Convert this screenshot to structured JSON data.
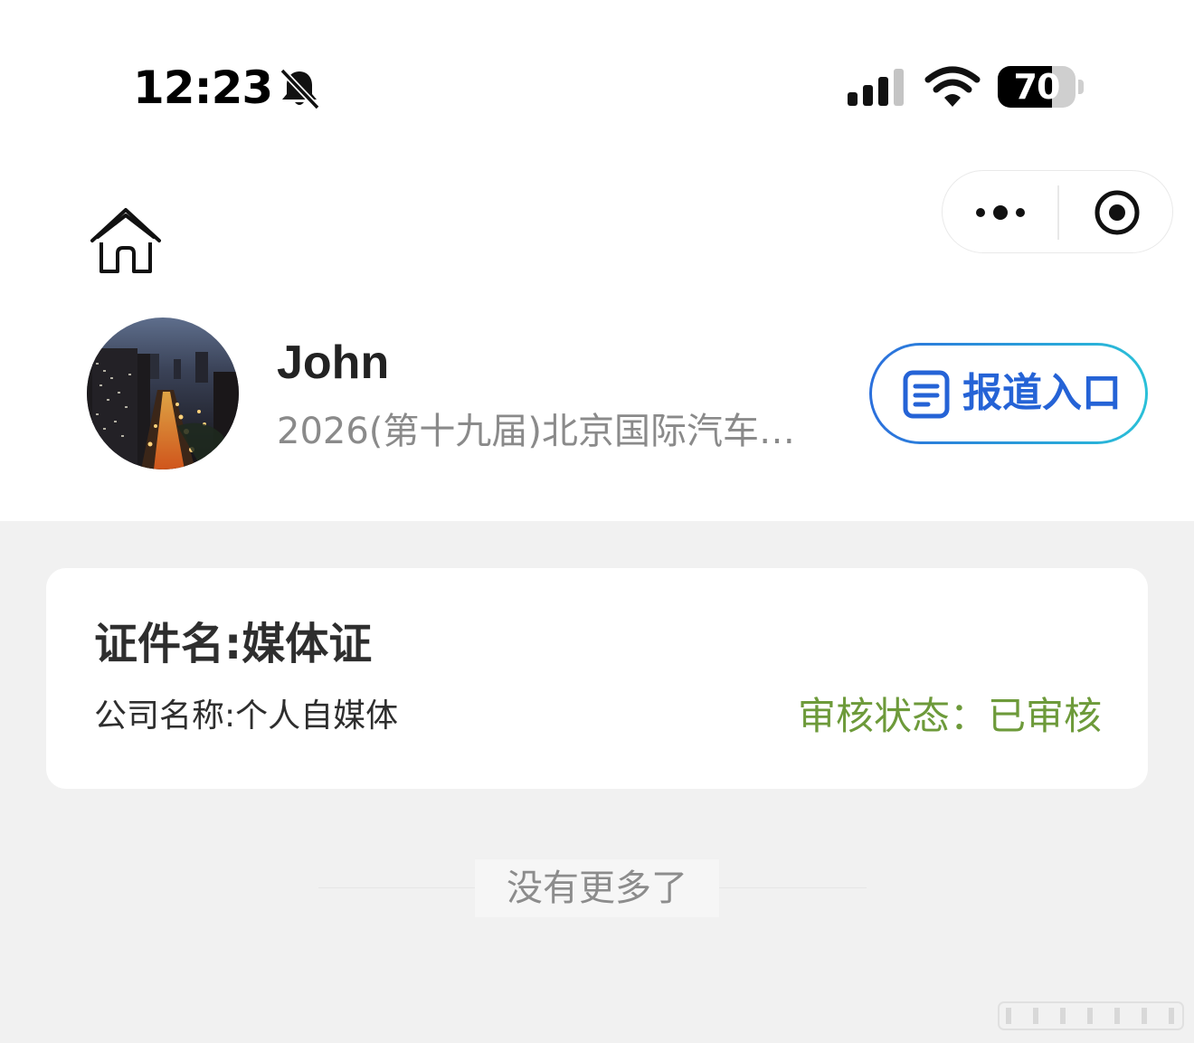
{
  "status_bar": {
    "time": "12:23",
    "silent_icon": "bell-slash-icon",
    "signal_icon": "cellular-signal-icon",
    "wifi_icon": "wifi-icon",
    "battery_level": "70",
    "battery_fraction": 0.7
  },
  "nav": {
    "home_icon": "home-icon",
    "more_icon": "more-dots-icon",
    "close_icon": "target-close-icon"
  },
  "profile": {
    "name": "John",
    "event": "2026(第十九届)北京国际汽车…",
    "report_button": "报道入口",
    "report_icon": "document-icon"
  },
  "card": {
    "cert_name": "证件名:媒体证",
    "company": "公司名称:个人自媒体",
    "status": "审核状态：已审核"
  },
  "footer": {
    "no_more": "没有更多了"
  },
  "colors": {
    "accent_blue": "#2563d6",
    "gradient_end": "#2ac0d8",
    "status_green": "#6d9a3a",
    "background": "#f1f1f1"
  }
}
